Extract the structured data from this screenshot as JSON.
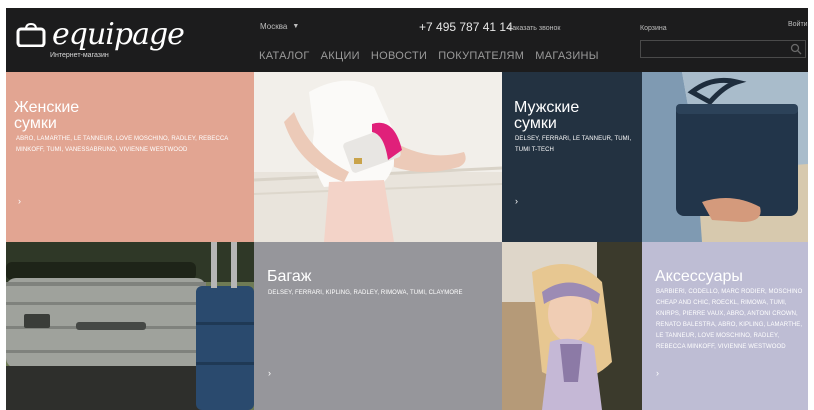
{
  "header": {
    "logo_text": "equipage",
    "tagline": "Интернет-магазин",
    "city": "Москва",
    "phone": "+7 495 787 41 14",
    "callback": "Заказать звонок",
    "cart": "Корзина",
    "login": "Войти",
    "search_placeholder": "",
    "nav": [
      "КАТАЛОГ",
      "АКЦИИ",
      "НОВОСТИ",
      "ПОКУПАТЕЛЯМ",
      "МАГАЗИНЫ"
    ]
  },
  "tiles": {
    "women": {
      "title": "Женские\nсумки",
      "brands": "ABRO, LAMARTHE, LE TANNEUR, LOVE MOSCHINO, RADLEY, REBECCA MINKOFF, TUMI, VANESSABRUNO, VIVIENNE WESTWOOD",
      "arrow": "›",
      "color": "#e2a592"
    },
    "men": {
      "title": "Мужские\nсумки",
      "brands": "DELSEY, FERRARI, LE TANNEUR, TUMI, TUMI T-TECH",
      "arrow": "›",
      "color": "#233241"
    },
    "luggage": {
      "title": "Багаж",
      "brands": "DELSEY, FERRARI, KIPLING, RADLEY, RIMOWA, TUMI, CLAYMORE",
      "arrow": "›",
      "color": "#96969b"
    },
    "accessories": {
      "title": "Аксессуары",
      "brands": "BARBIERI, CODELLO, MARC RODIER, MOSCHINO CHEAP AND CHIC, ROECKL, RIMOWA, TUMI, KNIRPS, PIERRE VAUX, ABRO, ANTONI CROWN, RENATO BALESTRA, ABRO, KIPLING, LAMARTHE, LE TANNEUR, LOVE MOSCHINO, RADLEY, REBECCA MINKOFF, VIVIENNE WESTWOOD",
      "arrow": "›",
      "color": "#bebdd4"
    }
  }
}
